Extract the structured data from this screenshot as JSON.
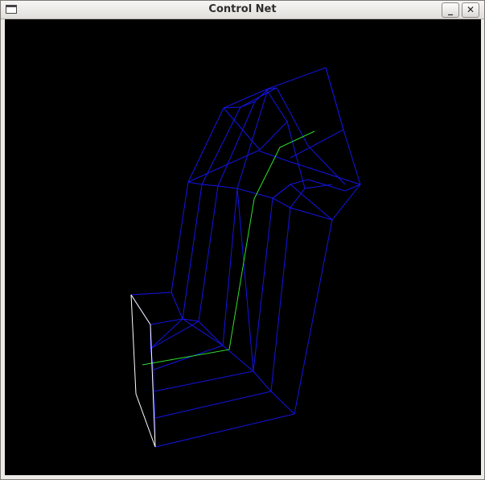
{
  "window": {
    "title": "Control Net",
    "minimize_label": "_",
    "close_label": "✕",
    "menu_icon": "window-menu-icon"
  },
  "viewport": {
    "background": "#000000",
    "colors": {
      "mesh": "#1414e6",
      "curve": "#2ee02e",
      "edge": "#ffffff"
    }
  }
}
